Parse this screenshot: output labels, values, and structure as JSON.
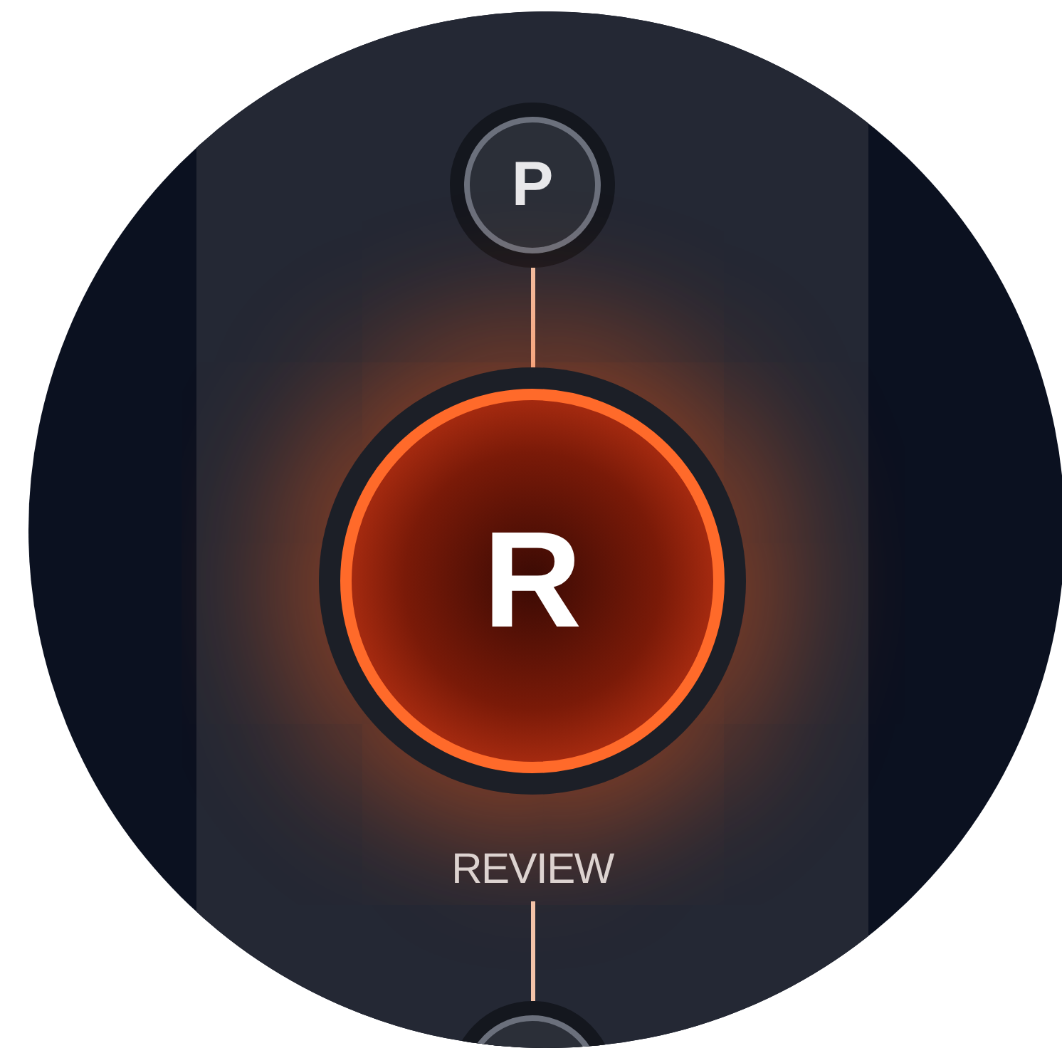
{
  "gears": [
    {
      "label": "P",
      "selected": false
    },
    {
      "label": "R",
      "selected": true,
      "caption": "REVIEW"
    },
    {
      "selected": false
    }
  ]
}
